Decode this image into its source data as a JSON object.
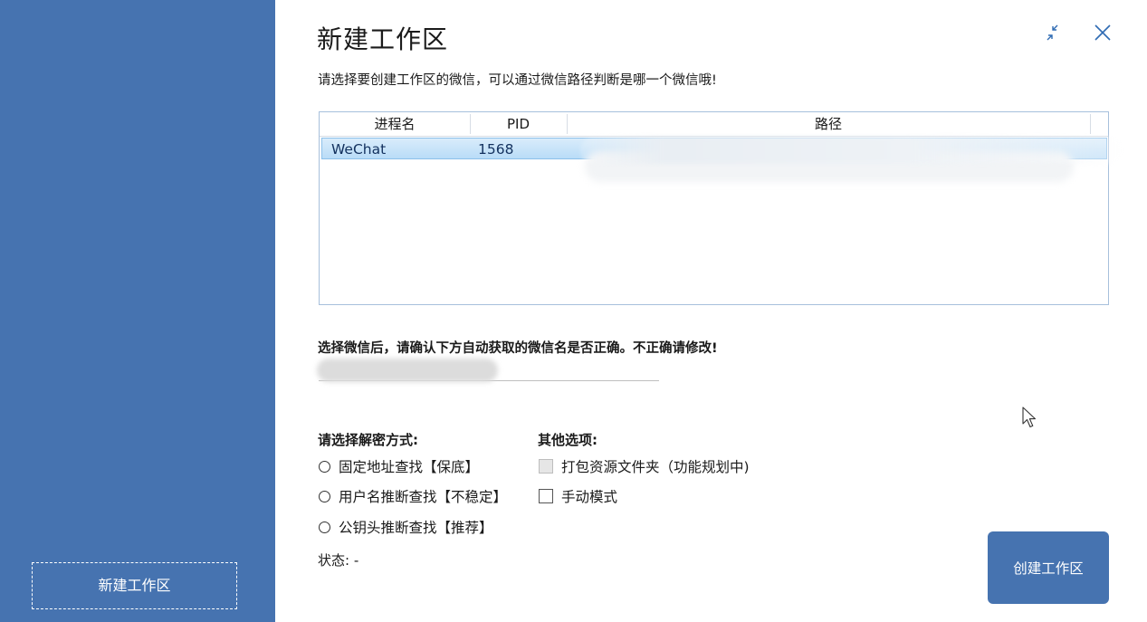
{
  "sidebar": {
    "new_workspace_label": "新建工作区"
  },
  "dialog": {
    "title": "新建工作区",
    "subtitle": "请选择要创建工作区的微信，可以通过微信路径判断是哪一个微信哦!",
    "minimize_icon": "collapse-arrows-icon",
    "close_icon": "close-icon"
  },
  "table": {
    "columns": [
      "进程名",
      "PID",
      "路径"
    ],
    "rows": [
      {
        "process": "WeChat",
        "pid": "1568",
        "path": ""
      }
    ]
  },
  "confirm": {
    "label": "选择微信后，请确认下方自动获取的微信名是否正确。不正确请修改!",
    "name_value": ""
  },
  "decrypt": {
    "label": "请选择解密方式:",
    "options": [
      "固定地址查找【保底】",
      "用户名推断查找【不稳定】",
      "公钥头推断查找【推荐】"
    ]
  },
  "other": {
    "label": "其他选项:",
    "options": [
      "打包资源文件夹（功能规划中)",
      "手动模式"
    ]
  },
  "status_text": "状态: -",
  "create_button_label": "创建工作区",
  "colors": {
    "sidebar": "#4673b0",
    "accent": "#4673b0",
    "selected_row": "#b9dcf7"
  }
}
